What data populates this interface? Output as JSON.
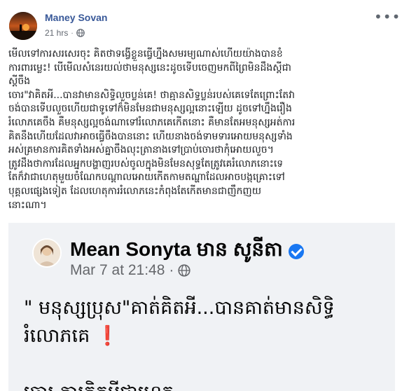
{
  "post": {
    "author": "Maney Sovan",
    "time": "21 hrs",
    "privacy_icon": "globe-icon",
    "menu_icon": "more-horizontal-icon",
    "text_lines": [
      "មើលទៅការសរសេរចុះ គិតថាទង្វើខ្លួនធ្វើហ្នឹងសមរម្យណាស់ហើយយ៉ាងបានខំ",
      "ការពារម្លេះ! បើមើលសំនេរយល់ថាមនុស្សនេះដូចទើបចេញមកពីព្រៃមិនដឹងស្ដីជា",
      "ស្ដីចឹង",
      "ចោរ\"វាគិតអី...បានវាមានសិទ្ធិលួចប្លន់គេ! ថាគ្មានសិទ្ធប្លន់របស់គេទេតែព្រោះតែវា",
      "ចង់បានទើបលួចហើយជាទូទៅក៏មិនមែនជាមនុស្សល្អនោះឡើយ ដូចទៅហ្នឹងរឿង",
      "រំលោភគេចឹង គឺមនុស្សល្អចង់ណាទៅរំលោភគេកើតនោះ គឺមានតែអមនុស្សអត់ការ",
      "គិតនឹងហើយដែលវាអាចធ្វើចឹងបាននោះ ហើយនាងចង់ទាមទារអោយមនុស្សទាំង",
      "អស់គ្រមានការគិតទាំងអស់គ្នាចឹងលុះត្រានាងទៅប្រាប់ចោរថាកុំអោយលួច។",
      "ត្រូវដឹងថាការដែលអ្នកបង្ហាញរបស់ចូលក្នុងមិនមែនសុទ្ធតែត្រូវគេរំលោភនោះទេ",
      "តែក៏វាជាហេតុមួយចំណែកបណ្ដាលអោយកើតកាមតណ្ហាដែលអាចបង្កគ្រោះទៅ",
      "បុគ្គលផ្សេងទៀត ដែលហេតុការរំលោភនេះកំពុងតែកើតមានជាញឹកញយ",
      "នោះណា។"
    ]
  },
  "shared": {
    "author": "Mean Sonyta មាន សូនីតា",
    "verified_icon": "verified-badge-icon",
    "time": "Mar 7 at 21:48",
    "privacy_icon": "globe-icon",
    "text_line1": "\" មនុស្សប្រុស\"គាត់គិតអី...បានគាត់មានសិទ្ធិ",
    "text_line2": "រំលោភគេ",
    "emoji": "❗",
    "cut_line": "ចោរ ការគិតអ្វីជាហេតុ"
  },
  "colors": {
    "author_link": "#385898",
    "meta_gray": "#616770",
    "verified_blue": "#1877f2",
    "shared_bg": "#f0f2f5",
    "exclamation_red": "#d10000"
  }
}
